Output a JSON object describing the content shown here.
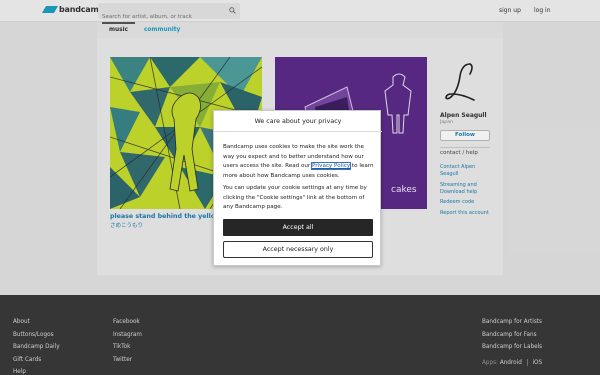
{
  "header": {
    "logo_text": "bandcamp",
    "search_placeholder": "Search for artist, album, or track",
    "search_icon": "search-icon",
    "signup": "sign up",
    "login": "log in"
  },
  "tabs": [
    {
      "label": "music"
    },
    {
      "label": "community"
    }
  ],
  "albums": [
    {
      "title": "please stand behind the yellow",
      "artist": "さめこうもり"
    },
    {
      "cover_text": "cakes"
    }
  ],
  "artist": {
    "name": "Alpen Seagull",
    "location": "Japan",
    "follow": "Follow",
    "contact_heading": "contact / help",
    "links": [
      "Contact Alpen Seagull",
      "Streaming and Download help",
      "Redeem code",
      "Report this account"
    ]
  },
  "cookie_dialog": {
    "title": "We care about your privacy",
    "p1_before": "Bandcamp uses cookies to make the site work the way you expect and to better understand how our users access the site. Read our ",
    "policy_link": "Privacy Policy",
    "p1_after": " to learn more about how Bandcamp uses cookies.",
    "p2": "You can update your cookie settings at any time by clicking the \"Cookie settings\" link at the bottom of any Bandcamp page.",
    "accept_all": "Accept all",
    "accept_necessary": "Accept necessary only"
  },
  "footer": {
    "col1": [
      "About",
      "Buttons/Logos",
      "Bandcamp Daily",
      "Gift Cards",
      "Help"
    ],
    "col2": [
      "Facebook",
      "Instagram",
      "TikTok",
      "Twitter"
    ],
    "col3": [
      "Bandcamp for Artists",
      "Bandcamp for Fans",
      "Bandcamp for Labels"
    ],
    "apps_label": "Apps:",
    "apps": [
      "Android",
      "iOS"
    ]
  },
  "colors": {
    "accent": "#1da0c3",
    "link": "#1d7fb0",
    "footer_bg": "#3a3a3a",
    "album1_bg": "#c8df2d",
    "album2_bg": "#5d2b8a"
  }
}
